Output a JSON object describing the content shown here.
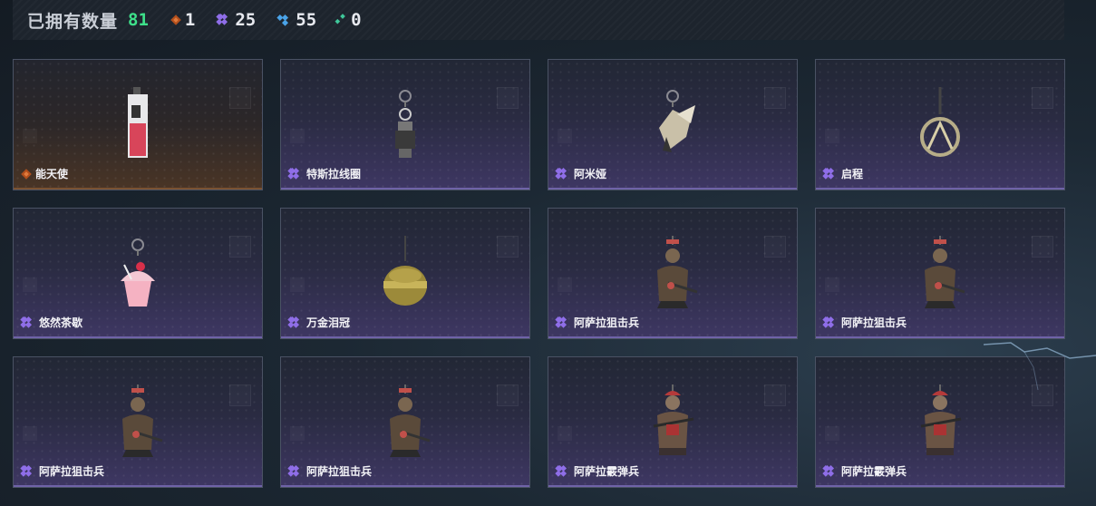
{
  "header": {
    "title": "已拥有数量",
    "total": "81",
    "stats": [
      {
        "rarity": "orange",
        "icon": "orange-rarity-icon",
        "value": "1"
      },
      {
        "rarity": "purple",
        "icon": "purple-rarity-icon",
        "value": "25"
      },
      {
        "rarity": "blue",
        "icon": "blue-rarity-icon",
        "value": "55"
      },
      {
        "rarity": "green",
        "icon": "green-rarity-icon",
        "value": "0"
      }
    ]
  },
  "colors": {
    "orange": "#e07a3c",
    "purple": "#8f6ee8",
    "blue": "#4aa3e8",
    "green": "#3fc79a",
    "total": "#3ee08a"
  },
  "items": [
    {
      "name": "能天使",
      "rarity": "orange",
      "art": "keychain-card"
    },
    {
      "name": "特斯拉线圈",
      "rarity": "purple",
      "art": "keychain-coil"
    },
    {
      "name": "阿米娅",
      "rarity": "purple",
      "art": "keychain-bunny"
    },
    {
      "name": "启程",
      "rarity": "purple",
      "art": "keychain-ring"
    },
    {
      "name": "悠然茶歇",
      "rarity": "purple",
      "art": "keychain-cupcake"
    },
    {
      "name": "万金泪冠",
      "rarity": "purple",
      "art": "keychain-crown"
    },
    {
      "name": "阿萨拉狙击兵",
      "rarity": "purple",
      "art": "keychain-soldier"
    },
    {
      "name": "阿萨拉狙击兵",
      "rarity": "purple",
      "art": "keychain-soldier"
    },
    {
      "name": "阿萨拉狙击兵",
      "rarity": "purple",
      "art": "keychain-soldier"
    },
    {
      "name": "阿萨拉狙击兵",
      "rarity": "purple",
      "art": "keychain-soldier"
    },
    {
      "name": "阿萨拉霰弹兵",
      "rarity": "purple",
      "art": "keychain-shotgunner"
    },
    {
      "name": "阿萨拉霰弹兵",
      "rarity": "purple",
      "art": "keychain-shotgunner"
    }
  ]
}
